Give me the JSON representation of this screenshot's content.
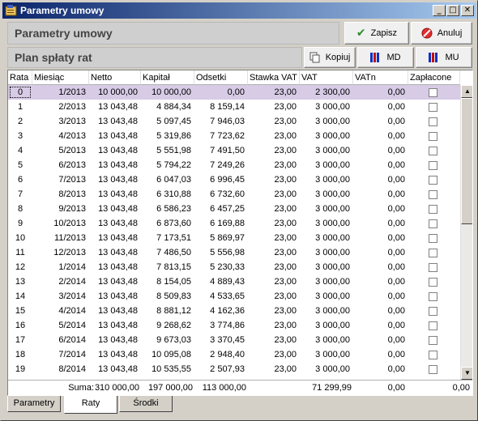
{
  "window": {
    "title": "Parametry umowy"
  },
  "header": {
    "title": "Parametry umowy",
    "save_label": "Zapisz",
    "cancel_label": "Anuluj",
    "colors": {
      "save_icon": "#2e8b2e",
      "cancel_icon": "#cc2222"
    }
  },
  "plan": {
    "title": "Plan spłaty rat",
    "copy_label": "Kopiuj",
    "md_label": "MD",
    "mu_label": "MU"
  },
  "table": {
    "columns": [
      "Rata",
      "Miesiąc",
      "Netto",
      "Kapitał",
      "Odsetki",
      "Stawka VAT",
      "VAT",
      "VATn",
      "Zapłacone"
    ],
    "rows": [
      [
        "0",
        "1/2013",
        "10 000,00",
        "10 000,00",
        "0,00",
        "23,00",
        "2 300,00",
        "0,00"
      ],
      [
        "1",
        "2/2013",
        "13 043,48",
        "4 884,34",
        "8 159,14",
        "23,00",
        "3 000,00",
        "0,00"
      ],
      [
        "2",
        "3/2013",
        "13 043,48",
        "5 097,45",
        "7 946,03",
        "23,00",
        "3 000,00",
        "0,00"
      ],
      [
        "3",
        "4/2013",
        "13 043,48",
        "5 319,86",
        "7 723,62",
        "23,00",
        "3 000,00",
        "0,00"
      ],
      [
        "4",
        "5/2013",
        "13 043,48",
        "5 551,98",
        "7 491,50",
        "23,00",
        "3 000,00",
        "0,00"
      ],
      [
        "5",
        "6/2013",
        "13 043,48",
        "5 794,22",
        "7 249,26",
        "23,00",
        "3 000,00",
        "0,00"
      ],
      [
        "6",
        "7/2013",
        "13 043,48",
        "6 047,03",
        "6 996,45",
        "23,00",
        "3 000,00",
        "0,00"
      ],
      [
        "7",
        "8/2013",
        "13 043,48",
        "6 310,88",
        "6 732,60",
        "23,00",
        "3 000,00",
        "0,00"
      ],
      [
        "8",
        "9/2013",
        "13 043,48",
        "6 586,23",
        "6 457,25",
        "23,00",
        "3 000,00",
        "0,00"
      ],
      [
        "9",
        "10/2013",
        "13 043,48",
        "6 873,60",
        "6 169,88",
        "23,00",
        "3 000,00",
        "0,00"
      ],
      [
        "10",
        "11/2013",
        "13 043,48",
        "7 173,51",
        "5 869,97",
        "23,00",
        "3 000,00",
        "0,00"
      ],
      [
        "11",
        "12/2013",
        "13 043,48",
        "7 486,50",
        "5 556,98",
        "23,00",
        "3 000,00",
        "0,00"
      ],
      [
        "12",
        "1/2014",
        "13 043,48",
        "7 813,15",
        "5 230,33",
        "23,00",
        "3 000,00",
        "0,00"
      ],
      [
        "13",
        "2/2014",
        "13 043,48",
        "8 154,05",
        "4 889,43",
        "23,00",
        "3 000,00",
        "0,00"
      ],
      [
        "14",
        "3/2014",
        "13 043,48",
        "8 509,83",
        "4 533,65",
        "23,00",
        "3 000,00",
        "0,00"
      ],
      [
        "15",
        "4/2014",
        "13 043,48",
        "8 881,12",
        "4 162,36",
        "23,00",
        "3 000,00",
        "0,00"
      ],
      [
        "16",
        "5/2014",
        "13 043,48",
        "9 268,62",
        "3 774,86",
        "23,00",
        "3 000,00",
        "0,00"
      ],
      [
        "17",
        "6/2014",
        "13 043,48",
        "9 673,03",
        "3 370,45",
        "23,00",
        "3 000,00",
        "0,00"
      ],
      [
        "18",
        "7/2014",
        "13 043,48",
        "10 095,08",
        "2 948,40",
        "23,00",
        "3 000,00",
        "0,00"
      ],
      [
        "19",
        "8/2014",
        "13 043,48",
        "10 535,55",
        "2 507,93",
        "23,00",
        "3 000,00",
        "0,00"
      ]
    ],
    "selected_row": 0,
    "sum": {
      "label": "Suma:",
      "netto": "310 000,00",
      "kapital": "197 000,00",
      "odsetki": "113 000,00",
      "vat": "71 299,99",
      "vatn": "0,00",
      "zaplacone": "0,00"
    }
  },
  "tabs": [
    "Parametry",
    "Raty",
    "Środki"
  ],
  "active_tab": 1
}
